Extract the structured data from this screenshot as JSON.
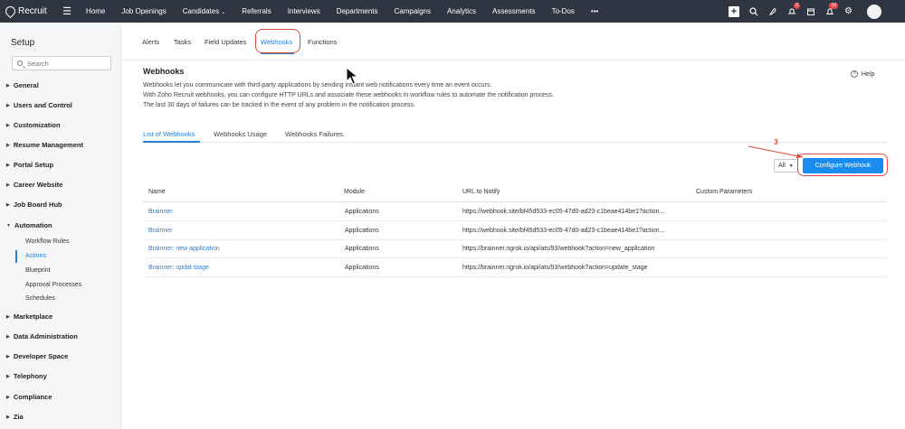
{
  "topnav": {
    "brand": "Recruit",
    "items": [
      "Home",
      "Job Openings",
      "Candidates",
      "Referrals",
      "Interviews",
      "Departments",
      "Campaigns",
      "Analytics",
      "Assessments",
      "To-Dos"
    ],
    "more": "•••",
    "plus": "+",
    "badges": {
      "bell_a": "3",
      "bell_b": "10"
    }
  },
  "sidebar": {
    "title": "Setup",
    "search_placeholder": "Search",
    "groups": [
      "General",
      "Users and Control",
      "Customization",
      "Resume Management",
      "Portal Setup",
      "Career Website",
      "Job Board Hub",
      "Automation",
      "Marketplace",
      "Data Administration",
      "Developer Space",
      "Telephony",
      "Compliance",
      "Zia"
    ],
    "automation_items": [
      "Workflow Rules",
      "Actions",
      "Blueprint",
      "Approval Processes",
      "Schedules"
    ],
    "active_item": "Actions"
  },
  "tabs": [
    "Alerts",
    "Tasks",
    "Field Updates",
    "Webhooks",
    "Functions"
  ],
  "active_tab": "Webhooks",
  "webhooks": {
    "title": "Webhooks",
    "desc_lines": [
      "Webhooks let you communicate with third-party applications by sending instant web notifications every time an event occurs.",
      "With Zoho Recruit webhooks, you can configure HTTP URLs and associate these webhooks in workflow rules to automate the notification process.",
      "The last 30 days of failures can be tracked in the event of any problem in the notification process."
    ],
    "help": "Help",
    "subtabs": [
      "List of Webhooks",
      "Webhooks Usage",
      "Webhooks Failures"
    ],
    "filter": "All",
    "configure_button": "Configure Webhook",
    "step_number": "3",
    "table": {
      "headers": [
        "Name",
        "Module",
        "URL to Notify",
        "Custom Parameters"
      ],
      "rows": [
        {
          "name": "Brainner",
          "module": "Applications",
          "url": "https://webhook.site/bf45d533-ec05-47d0-ad23-c1beae414be1?action...",
          "params": ""
        },
        {
          "name": "Brainner",
          "module": "Applications",
          "url": "https://webhook.site/bf45d533-ec05-47d0-ad23-c1beae414be1?action...",
          "params": ""
        },
        {
          "name": "Brainner: new application",
          "module": "Applications",
          "url": "https://brainner.ngrok.io/api/ats/93/webhook?action=new_application",
          "params": ""
        },
        {
          "name": "Brainner: updat stage",
          "module": "Applications",
          "url": "https://brainner.ngrok.io/api/ats/93/webhook?action=update_stage",
          "params": ""
        }
      ]
    }
  },
  "colors": {
    "accent": "#1a8cf0",
    "nav_bg": "#2f3642",
    "annotation": "#e04a3f"
  }
}
